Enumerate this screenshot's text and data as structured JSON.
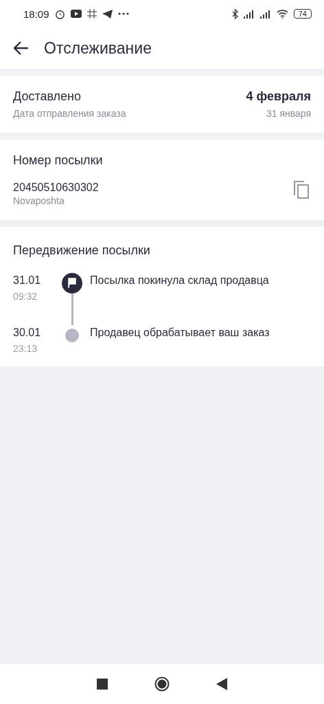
{
  "status_bar": {
    "time": "18:09",
    "battery": "74"
  },
  "header": {
    "title": "Отслеживание"
  },
  "delivery": {
    "status": "Доставлено",
    "date": "4 февраля",
    "subtitle": "Дата отправления заказа",
    "sent_date": "31 января"
  },
  "parcel": {
    "title": "Номер посылки",
    "number": "20450510630302",
    "carrier": "Novaposhta"
  },
  "movement": {
    "title": "Передвижение посылки",
    "events": [
      {
        "kind": "current",
        "date": "31.01",
        "time": "09:32",
        "text": "Посылка покинула склад продавца"
      },
      {
        "kind": "past",
        "date": "30.01",
        "time": "23:13",
        "text": "Продавец обрабатывает ваш заказ"
      }
    ]
  }
}
